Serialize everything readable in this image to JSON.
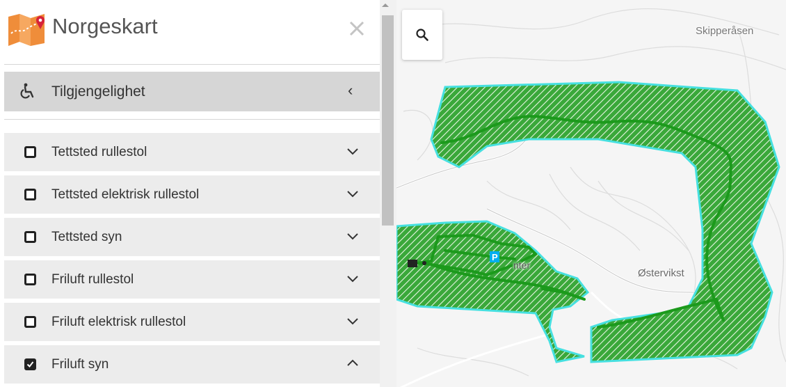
{
  "header": {
    "title": "Norgeskart",
    "close_symbol": "✕"
  },
  "section": {
    "label": "Tilgjengelighet",
    "chevron": "‹",
    "icon": "wheelchair-icon"
  },
  "layers": [
    {
      "label": "Tettsted rullestol",
      "checked": false
    },
    {
      "label": "Tettsted elektrisk rullestol",
      "checked": false
    },
    {
      "label": "Tettsted syn",
      "checked": false
    },
    {
      "label": "Friluft rullestol",
      "checked": false
    },
    {
      "label": "Friluft elektrisk rullestol",
      "checked": false
    },
    {
      "label": "Friluft syn",
      "checked": true
    }
  ],
  "map": {
    "places": {
      "skipperasen": "Skipperåsen",
      "ostervikst": "Østervikst",
      "innenter": "nter"
    },
    "parking": "P",
    "colors": {
      "area_fill": "#2aa52a",
      "area_border": "#3fe3e3",
      "trail": "#1e9e1e",
      "base": "#f5f5f5"
    }
  }
}
